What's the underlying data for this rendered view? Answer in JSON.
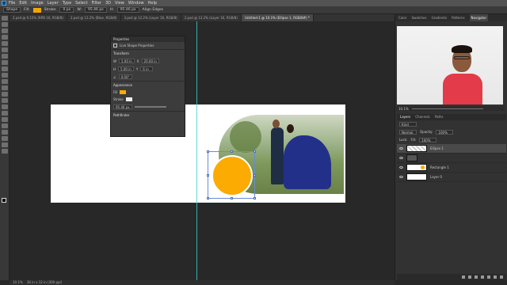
{
  "menubar": {
    "logo": "Ps",
    "items": [
      "File",
      "Edit",
      "Image",
      "Layer",
      "Type",
      "Select",
      "Filter",
      "3D",
      "View",
      "Window",
      "Help"
    ]
  },
  "options": {
    "shape_mode": "Shape",
    "fill_label": "Fill:",
    "stroke_label": "Stroke:",
    "stroke_size": "0 px",
    "w_label": "W:",
    "w_value": "95.46 px",
    "h_label": "H:",
    "h_value": "95.46 px",
    "align_edges": "Align Edges"
  },
  "tabs": [
    {
      "label": "2.psd @ 9.15% (RPB 16, RGB/8)",
      "active": false
    },
    {
      "label": "2.psd @ 13.2% (Blue, RGB/8)",
      "active": false
    },
    {
      "label": "3.psd @ 12.2% (Layer 16, RGB/8)",
      "active": false
    },
    {
      "label": "2.psd @ 13.2% (Layer 16, RGB/8)",
      "active": false
    },
    {
      "label": "Untitled-1 @ 10.1% (Ellipse 1, RGB/8#) *",
      "active": true
    }
  ],
  "properties": {
    "title": "Properties",
    "subtitle": "Live Shape Properties",
    "transform_label": "Transform",
    "w": "5.00 in",
    "x": "20.00 in",
    "h": "5.00 in",
    "y": "6 in",
    "angle": "0.00°",
    "appearance_label": "Appearance",
    "fill_label": "Fill",
    "stroke_label": "Stroke",
    "stroke_width": "95.46 px",
    "pathfinder_label": "Pathfinder",
    "fill_color": "#fbab02"
  },
  "right_panel": {
    "top_tabs": [
      "Color",
      "Swatches",
      "Gradients",
      "Patterns",
      "Navigator"
    ],
    "zoom": "10.1%"
  },
  "layers_panel": {
    "tabs": [
      "Layers",
      "Channels",
      "Paths"
    ],
    "kind": "Kind",
    "blend_mode": "Normal",
    "opacity_label": "Opacity:",
    "opacity_value": "100%",
    "lock_label": "Lock:",
    "fill_label": "Fill:",
    "fill_value": "100%",
    "rows": [
      {
        "name": "Ellipse 1",
        "selected": true
      },
      {
        "name": "",
        "selected": false
      },
      {
        "name": "Rectangle 1",
        "selected": false
      },
      {
        "name": "Layer 0",
        "selected": false
      }
    ]
  },
  "status": {
    "zoom_info": "10.1%",
    "doc_info": "36 in x 12 in (300 ppi)"
  },
  "colors": {
    "accent_orange": "#fbab02",
    "guide": "#3ad1d1"
  }
}
